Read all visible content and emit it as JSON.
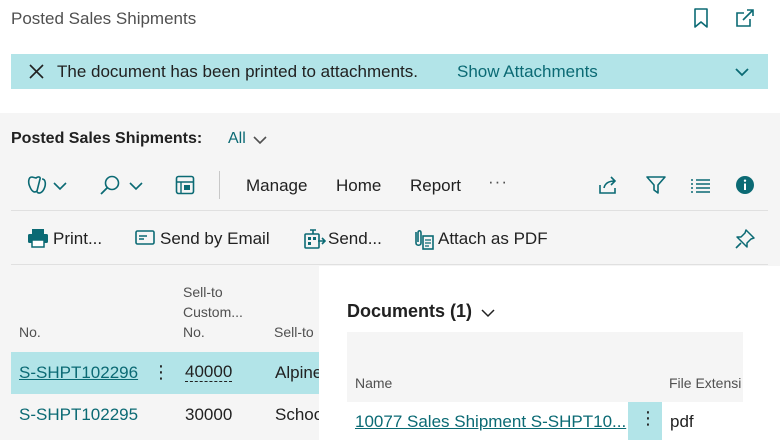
{
  "page": {
    "title": "Posted Sales Shipments"
  },
  "banner": {
    "message": "The document has been printed to attachments.",
    "link": "Show Attachments"
  },
  "list": {
    "title": "Posted Sales Shipments:",
    "filter": "All"
  },
  "menu": {
    "manage": "Manage",
    "home": "Home",
    "report": "Report",
    "more": "···"
  },
  "actions": {
    "print": "Print...",
    "send_by_email": "Send by Email",
    "send": "Send...",
    "attach_pdf": "Attach as PDF"
  },
  "columns": {
    "no": "No.",
    "sell_to_cust_no_l1": "Sell-to",
    "sell_to_cust_no_l2": "Custom...",
    "sell_to_cust_no_l3": "No.",
    "sell_to_name": "Sell-to"
  },
  "rows": [
    {
      "no": "S-SHPT102296",
      "customer_no": "40000",
      "name": "Alpine"
    },
    {
      "no": "S-SHPT102295",
      "customer_no": "30000",
      "name": "Schoo"
    }
  ],
  "factbox": {
    "title": "Documents (1)",
    "col_name": "Name",
    "col_ext": "File Extensi",
    "row_name": "10077 Sales Shipment S-SHPT10...",
    "row_ext": "pdf"
  },
  "colors": {
    "accent": "#0b6a74",
    "banner_bg": "#b2e4e8",
    "info": "#0b6a74"
  }
}
